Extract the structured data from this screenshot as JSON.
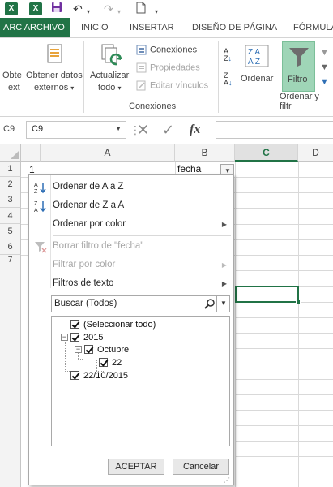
{
  "colors": {
    "excel_green": "#217346",
    "accent_select": "#217346",
    "filter_active": "#9fd5b7"
  },
  "qat": {
    "icons": [
      "excel-icon",
      "excel-icon",
      "save-icon",
      "undo-icon",
      "redo-icon",
      "new-doc-icon"
    ]
  },
  "tabs": {
    "file_prefix": "ARC",
    "file_label": "ARCHIVO",
    "items": [
      "INICIO",
      "INSERTAR",
      "DISEÑO DE PÁGINA",
      "FÓRMULA"
    ]
  },
  "ribbon": {
    "obtener_cut_1": "Obte",
    "obtener_cut_2": "ext",
    "obtener_line1": "Obtener datos",
    "obtener_line2": "externos",
    "actualizar_line1": "Actualizar",
    "actualizar_line2": "todo",
    "conexiones": "Conexiones",
    "propiedades": "Propiedades",
    "editar_vinculos": "Editar vínculos",
    "group_conexiones": "Conexiones",
    "ordenar": "Ordenar",
    "filtro": "Filtro",
    "group_ordenar": "Ordenar y filtr"
  },
  "formula_bar": {
    "namebox_prefix": "C9",
    "namebox_value": "C9",
    "fx": "fx"
  },
  "grid": {
    "col_a": "A",
    "col_b": "B",
    "col_c": "C",
    "col_d": "D",
    "rows": [
      "1",
      "2",
      "3",
      "4",
      "5",
      "6",
      "7"
    ],
    "a1": "1",
    "b1": "fecha"
  },
  "dropdown": {
    "sort_az": "Ordenar de A a Z",
    "sort_za": "Ordenar de Z a A",
    "sort_color": "Ordenar por color",
    "clear_filter": "Borrar filtro de \"fecha\"",
    "filter_color": "Filtrar por color",
    "text_filters": "Filtros de texto",
    "search_text": "Buscar (Todos)",
    "tree": {
      "select_all": "(Seleccionar todo)",
      "year": "2015",
      "month": "Octubre",
      "day": "22",
      "date": "22/10/2015"
    },
    "ok": "ACEPTAR",
    "cancel": "Cancelar"
  }
}
